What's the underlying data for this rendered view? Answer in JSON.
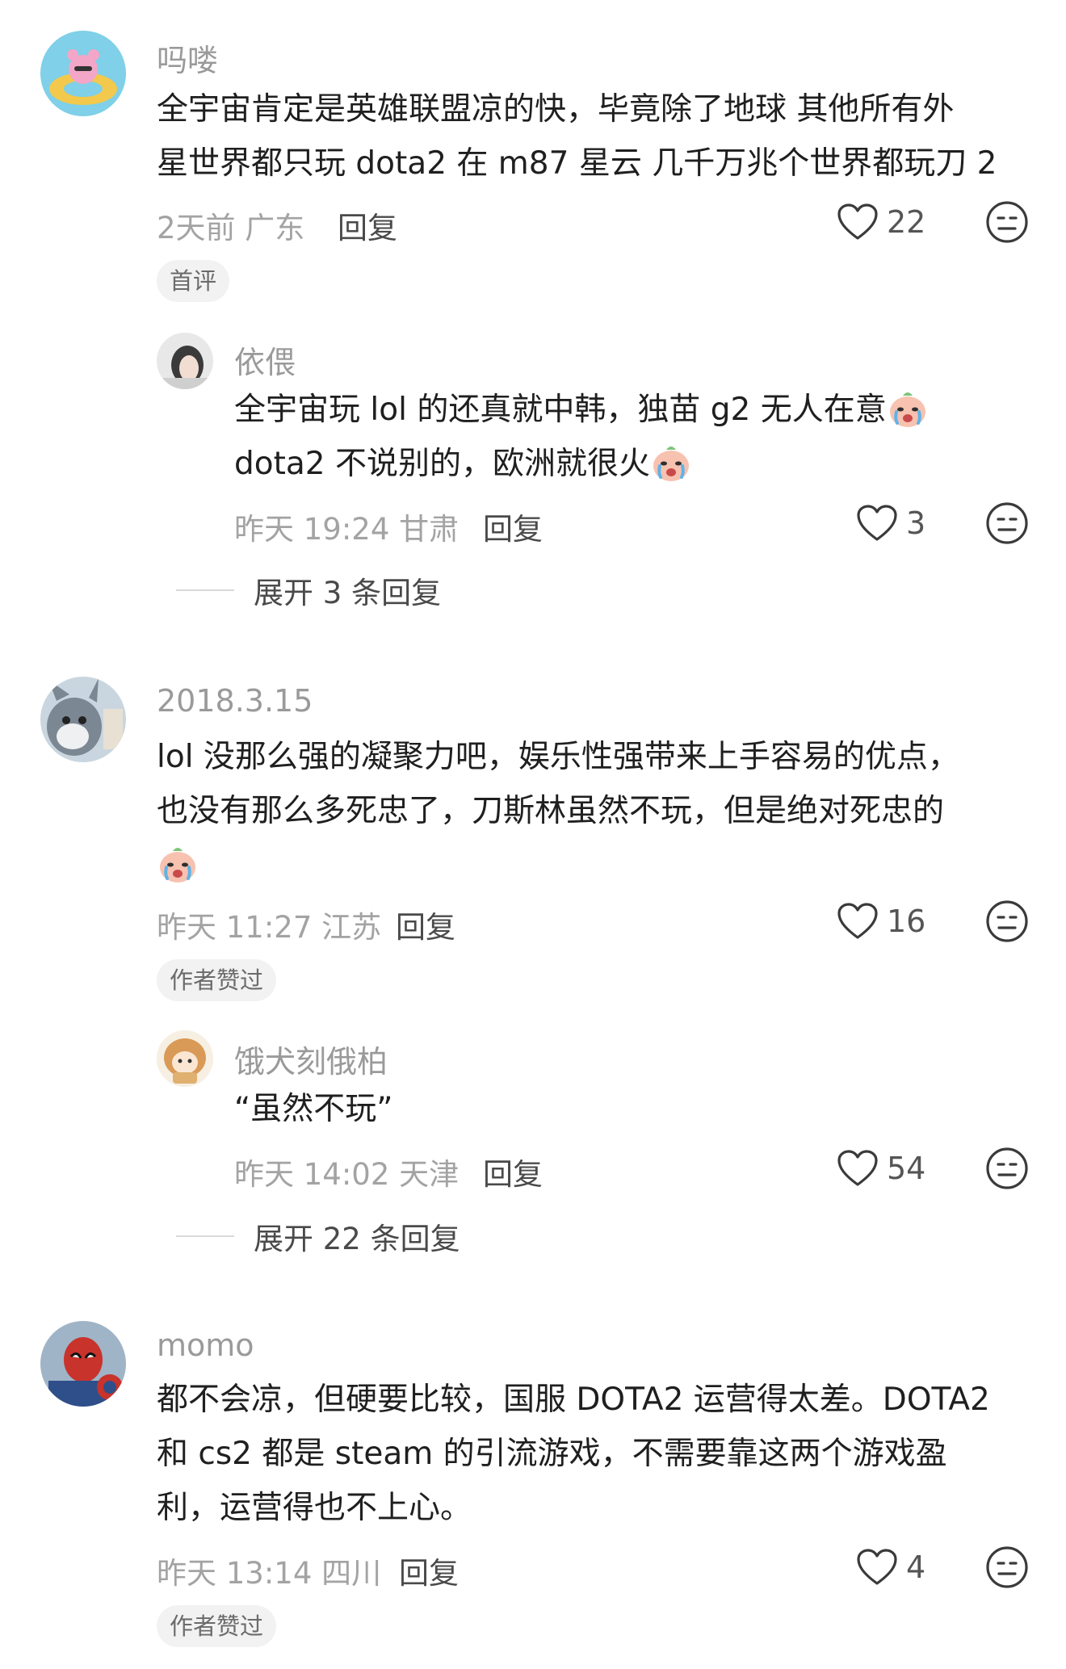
{
  "comments": [
    {
      "username": "吗喽",
      "lines": [
        "全宇宙肯定是英雄联盟凉的快，毕竟除了地球 其他所有外",
        "星世界都只玩 dota2 在 m87 星云 几千万兆个世界都玩刀 2"
      ],
      "meta": "2天前 广东",
      "reply_label": "回复",
      "likes": "22",
      "badge": "首评",
      "sub_reply": {
        "username": "依偎",
        "lines": [
          "全宇宙玩 lol 的还真就中韩，独苗 g2 无人在意",
          "dota2 不说别的，欧洲就很火"
        ],
        "meta": "昨天 19:24 甘肃",
        "reply_label": "回复",
        "likes": "3"
      },
      "expand_label": "展开 3 条回复"
    },
    {
      "username": "2018.3.15",
      "lines": [
        "lol 没那么强的凝聚力吧，娱乐性强带来上手容易的优点，",
        "也没有那么多死忠了，刀斯林虽然不玩，但是绝对死忠的"
      ],
      "meta": "昨天 11:27 江苏",
      "reply_label": "回复",
      "likes": "16",
      "badge": "作者赞过",
      "sub_reply": {
        "username": "饿犬刻俄柏",
        "lines": [
          "“虽然不玩”"
        ],
        "meta": "昨天 14:02 天津",
        "reply_label": "回复",
        "likes": "54"
      },
      "expand_label": "展开 22 条回复"
    },
    {
      "username": "momo",
      "lines": [
        "都不会凉，但硬要比较，国服 DOTA2 运营得太差。DOTA2",
        "和 cs2 都是 steam 的引流游戏，不需要靠这两个游戏盈",
        "利，运营得也不上心。"
      ],
      "meta": "昨天 13:14 四川",
      "reply_label": "回复",
      "likes": "4",
      "badge": "作者赞过"
    }
  ],
  "icons": {
    "like": "heart-outline-icon",
    "dislike": "meh-face-icon",
    "emoji": "crying-face-emoji"
  },
  "colors": {
    "text": "#1f1f1f",
    "username": "#9a9a9a",
    "meta": "#a3a3a3",
    "badge_bg": "#f2f2f2"
  }
}
